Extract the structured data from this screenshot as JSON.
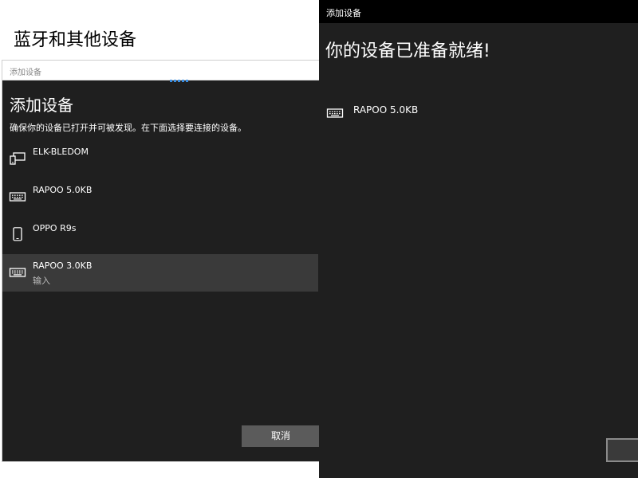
{
  "settings": {
    "page_title": "蓝牙和其他设备"
  },
  "add_dialog": {
    "window_title": "添加设备",
    "heading": "添加设备",
    "instruction": "确保你的设备已打开并可被发现。在下面选择要连接的设备。",
    "devices": [
      {
        "name": "ELK-BLEDOM",
        "subtitle": "",
        "icon": "display-icon",
        "selected": false
      },
      {
        "name": "RAPOO 5.0KB",
        "subtitle": "",
        "icon": "keyboard-icon",
        "selected": false
      },
      {
        "name": "OPPO R9s",
        "subtitle": "",
        "icon": "phone-icon",
        "selected": false
      },
      {
        "name": "RAPOO 3.0KB",
        "subtitle": "输入",
        "icon": "keyboard-icon",
        "selected": true
      }
    ],
    "cancel_label": "取消"
  },
  "ready_dialog": {
    "window_title": "添加设备",
    "heading": "你的设备已准备就绪!",
    "device": {
      "name": "RAPOO 5.0KB",
      "icon": "keyboard-icon"
    },
    "done_label": ""
  },
  "colors": {
    "dialog_bg": "#1f1f1f",
    "selected_bg": "#3a3a3a",
    "accent": "#3a8de0",
    "button_bg": "#5b5b5b"
  }
}
